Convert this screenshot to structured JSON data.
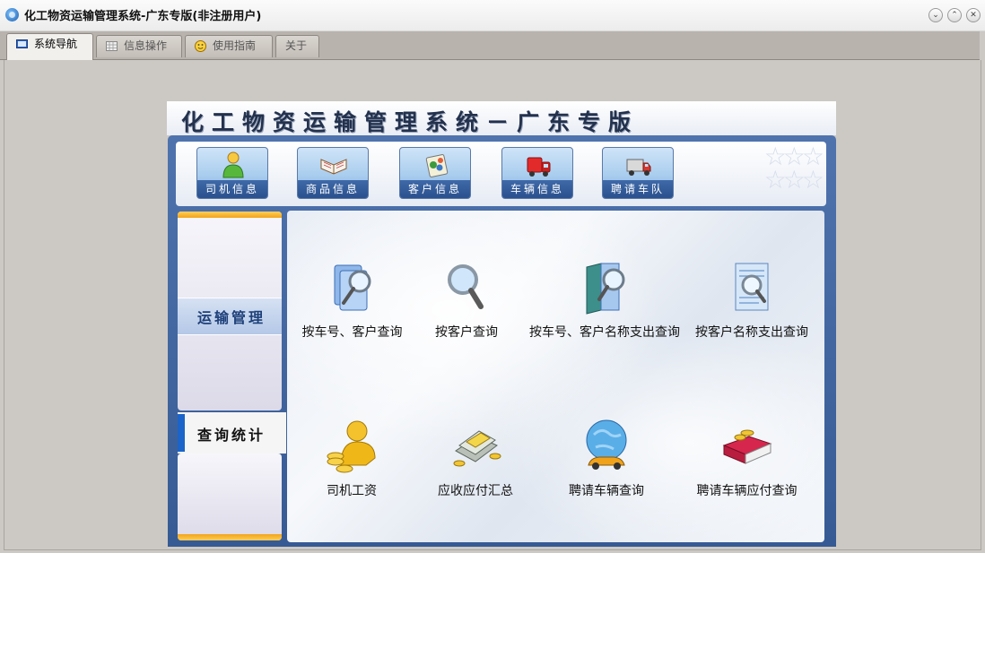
{
  "window": {
    "title": "化工物资运输管理系统-广东专版(非注册用户)",
    "controls": [
      "⌄",
      "⌃",
      "✕"
    ]
  },
  "tabs": [
    {
      "label": "系统导航",
      "icon": "monitor-icon",
      "active": true
    },
    {
      "label": "信息操作",
      "icon": "grid-icon",
      "active": false
    },
    {
      "label": "使用指南",
      "icon": "smiley-icon",
      "active": false
    },
    {
      "label": "关于",
      "icon": "",
      "active": false
    }
  ],
  "banner": {
    "title": "化工物资运输管理系统－广东专版"
  },
  "toolbar": {
    "buttons": [
      {
        "label": "司机信息",
        "icon": "driver-person-icon"
      },
      {
        "label": "商品信息",
        "icon": "open-book-icon"
      },
      {
        "label": "客户信息",
        "icon": "customer-map-icon"
      },
      {
        "label": "车辆信息",
        "icon": "red-truck-icon"
      },
      {
        "label": "聘请车队",
        "icon": "hired-truck-icon"
      }
    ]
  },
  "sidebar": {
    "categories": [
      {
        "label": "运输管理",
        "selected": false
      },
      {
        "label": "查询统计",
        "selected": true
      }
    ]
  },
  "content": {
    "items": [
      {
        "label": "按车号、客户查询",
        "icon": "document-magnifier-icon"
      },
      {
        "label": "按客户查询",
        "icon": "magnifier-icon"
      },
      {
        "label": "按车号、客户名称支出查询",
        "icon": "binder-magnifier-icon"
      },
      {
        "label": "按客户名称支出查询",
        "icon": "page-magnifier-icon"
      },
      {
        "label": "司机工资",
        "icon": "coins-person-icon"
      },
      {
        "label": "应收应付汇总",
        "icon": "money-stack-icon"
      },
      {
        "label": "聘请车辆查询",
        "icon": "globe-car-icon"
      },
      {
        "label": "聘请车辆应付查询",
        "icon": "book-coins-icon"
      }
    ]
  },
  "colors": {
    "accent": "#1b64c9",
    "frame_blue": "#4f73ad",
    "sidebar_orange": "#f2a317"
  }
}
